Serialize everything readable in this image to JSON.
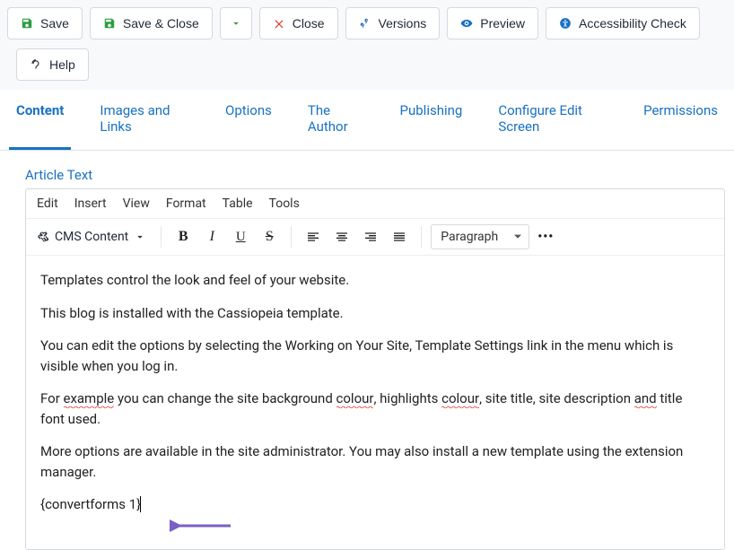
{
  "toolbar": {
    "save": "Save",
    "save_close": "Save & Close",
    "close": "Close",
    "versions": "Versions",
    "preview": "Preview",
    "accessibility": "Accessibility Check",
    "help": "Help"
  },
  "tabs": {
    "content": "Content",
    "images_links": "Images and Links",
    "options": "Options",
    "author": "The Author",
    "publishing": "Publishing",
    "configure": "Configure Edit Screen",
    "permissions": "Permissions"
  },
  "editor": {
    "field_label": "Article Text",
    "menubar": {
      "edit": "Edit",
      "insert": "Insert",
      "view": "View",
      "format": "Format",
      "table": "Table",
      "tools": "Tools"
    },
    "cms_content_label": "CMS Content",
    "block_format": "Paragraph",
    "body": {
      "p1": "Templates control the look and feel of your website.",
      "p2": "This blog is installed with the Cassiopeia template.",
      "p3a": "You can edit the options by selecting the Working on Your Site, Template Settings link in the menu which is visible when you log in.",
      "p4_pre": "For ",
      "p4_sp1": "example",
      "p4_mid1": " you can change the site background ",
      "p4_sp2": "colour",
      "p4_mid2": ", highlights ",
      "p4_sp3": "colour",
      "p4_mid3": ", site title, site description ",
      "p4_sp4": "and",
      "p4_post": " title font used.",
      "p5": "More options are available in the site administrator. You may also install a new template using the extension manager.",
      "p6": "{convertforms 1}"
    }
  }
}
